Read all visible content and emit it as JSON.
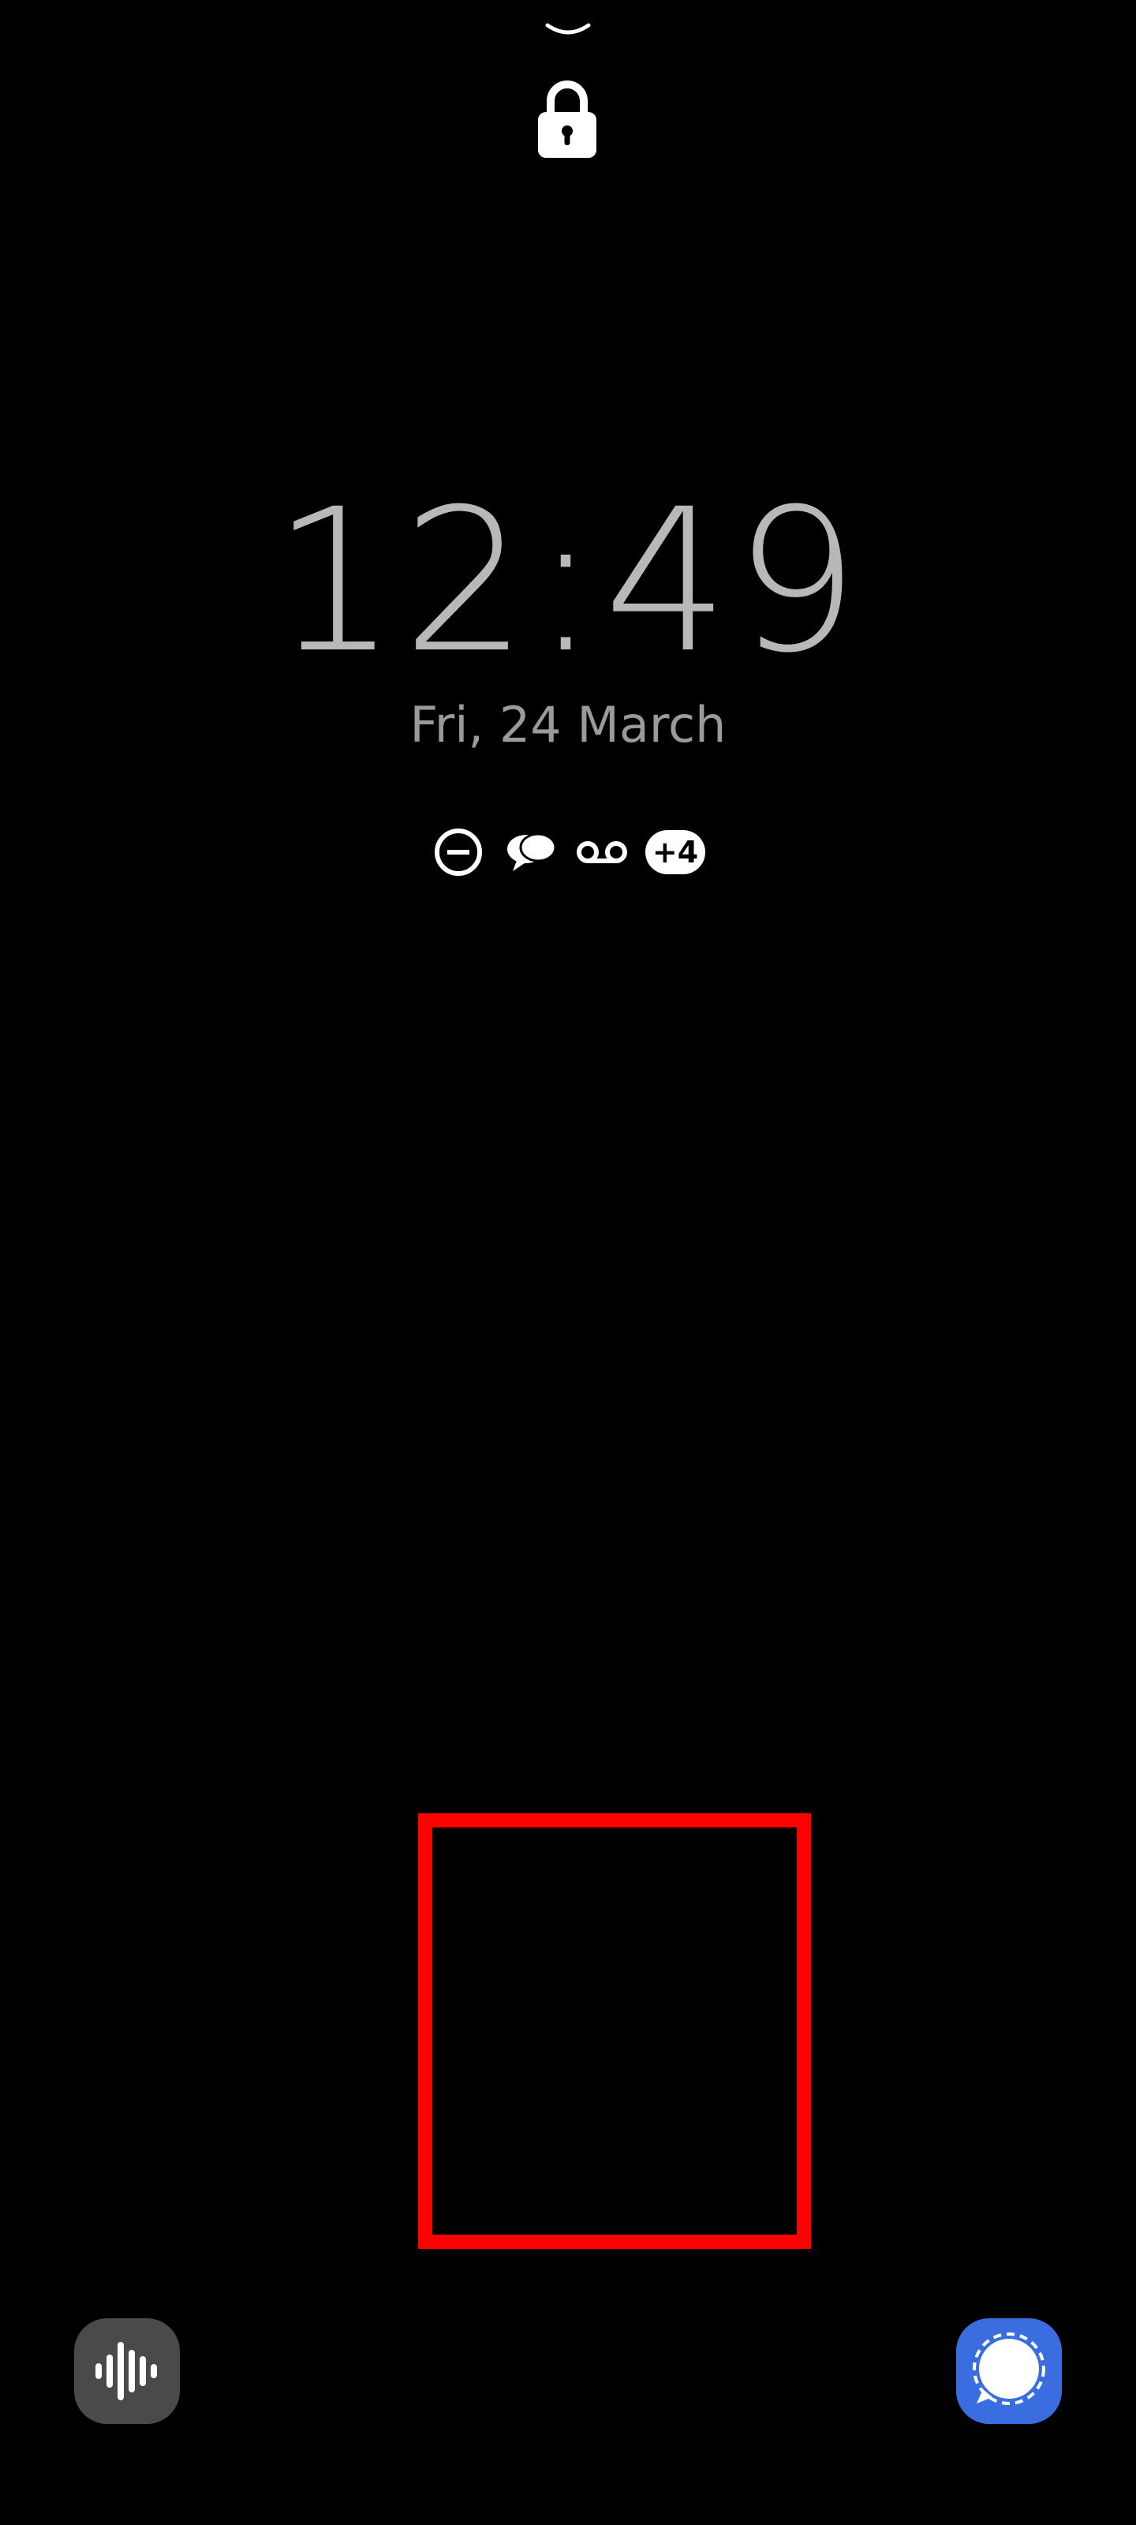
{
  "lock_screen": {
    "time": "12:49",
    "date": "Fri, 24 March"
  },
  "notifications": {
    "icons": [
      "do-not-disturb-icon",
      "chat-bubbles-icon",
      "voicemail-icon"
    ],
    "more_count": "+4"
  },
  "shortcuts": {
    "left": "voice-recorder-icon",
    "right": "signal-icon"
  },
  "colors": {
    "background": "#000000",
    "clock": "#b8b8b8",
    "date": "#9a9a9a",
    "highlight": "#ff0000",
    "left_shortcut_bg": "#4a4a4a",
    "right_shortcut_bg": "#3a6ee0"
  }
}
